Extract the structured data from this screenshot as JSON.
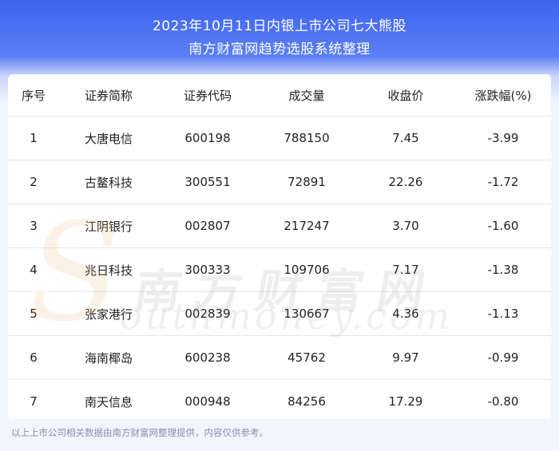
{
  "header": {
    "title_line1": "2023年10月11日内银上市公司七大熊股",
    "title_line2": "南方财富网趋势选股系统整理"
  },
  "table": {
    "columns": [
      "序号",
      "证券简称",
      "证券代码",
      "成交量",
      "收盘价",
      "涨跌幅(%)"
    ],
    "rows": [
      [
        "1",
        "大唐电信",
        "600198",
        "788150",
        "7.45",
        "-3.99"
      ],
      [
        "2",
        "古鳌科技",
        "300551",
        "72891",
        "22.26",
        "-1.72"
      ],
      [
        "3",
        "江阴银行",
        "002807",
        "217247",
        "3.70",
        "-1.60"
      ],
      [
        "4",
        "兆日科技",
        "300333",
        "109706",
        "7.17",
        "-1.38"
      ],
      [
        "5",
        "张家港行",
        "002839",
        "130667",
        "4.36",
        "-1.13"
      ],
      [
        "6",
        "海南椰岛",
        "600238",
        "45762",
        "9.97",
        "-0.99"
      ],
      [
        "7",
        "南天信息",
        "000948",
        "84256",
        "17.29",
        "-0.80"
      ]
    ]
  },
  "watermark": {
    "cn": "南方财富网",
    "en": "outhmoney.com",
    "letter": "S"
  },
  "footer": {
    "note": "以上上市公司相关数据由南方财富网整理提供，内容仅供参考。"
  }
}
